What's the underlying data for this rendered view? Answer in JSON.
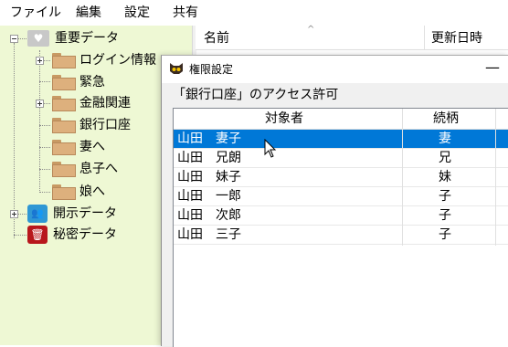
{
  "menu": {
    "items": [
      "ファイル",
      "編集",
      "設定",
      "共有"
    ]
  },
  "tree": {
    "root": {
      "label": "重要データ",
      "icon": "heart-folder-icon"
    },
    "children": [
      {
        "label": "ログイン情報",
        "icon": "folder-icon",
        "expandable": true
      },
      {
        "label": "緊急",
        "icon": "folder-icon",
        "expandable": false
      },
      {
        "label": "金融関連",
        "icon": "folder-icon",
        "expandable": true
      },
      {
        "label": "銀行口座",
        "icon": "folder-icon",
        "expandable": false
      },
      {
        "label": "妻へ",
        "icon": "folder-icon",
        "expandable": false
      },
      {
        "label": "息子へ",
        "icon": "folder-icon",
        "expandable": false
      },
      {
        "label": "娘へ",
        "icon": "folder-icon",
        "expandable": false
      }
    ],
    "others": [
      {
        "label": "開示データ",
        "icon": "people-icon",
        "expandable": true
      },
      {
        "label": "秘密データ",
        "icon": "trash-icon",
        "expandable": false
      }
    ]
  },
  "list": {
    "columns": [
      "名前",
      "更新日時"
    ]
  },
  "dialog": {
    "title": "権限設定",
    "minimize": "—",
    "label": "「銀行口座」のアクセス許可",
    "columns": [
      "対象者",
      "続柄"
    ],
    "rows": [
      {
        "name": "山田　妻子",
        "relation": "妻",
        "selected": true
      },
      {
        "name": "山田　兄朗",
        "relation": "兄",
        "selected": false
      },
      {
        "name": "山田　妹子",
        "relation": "妹",
        "selected": false
      },
      {
        "name": "山田　一郎",
        "relation": "子",
        "selected": false
      },
      {
        "name": "山田　次郎",
        "relation": "子",
        "selected": false
      },
      {
        "name": "山田　三子",
        "relation": "子",
        "selected": false
      }
    ]
  },
  "colors": {
    "tree_bg": "#eef8d4",
    "selection": "#0078d7",
    "folder": "#ddb07d"
  }
}
